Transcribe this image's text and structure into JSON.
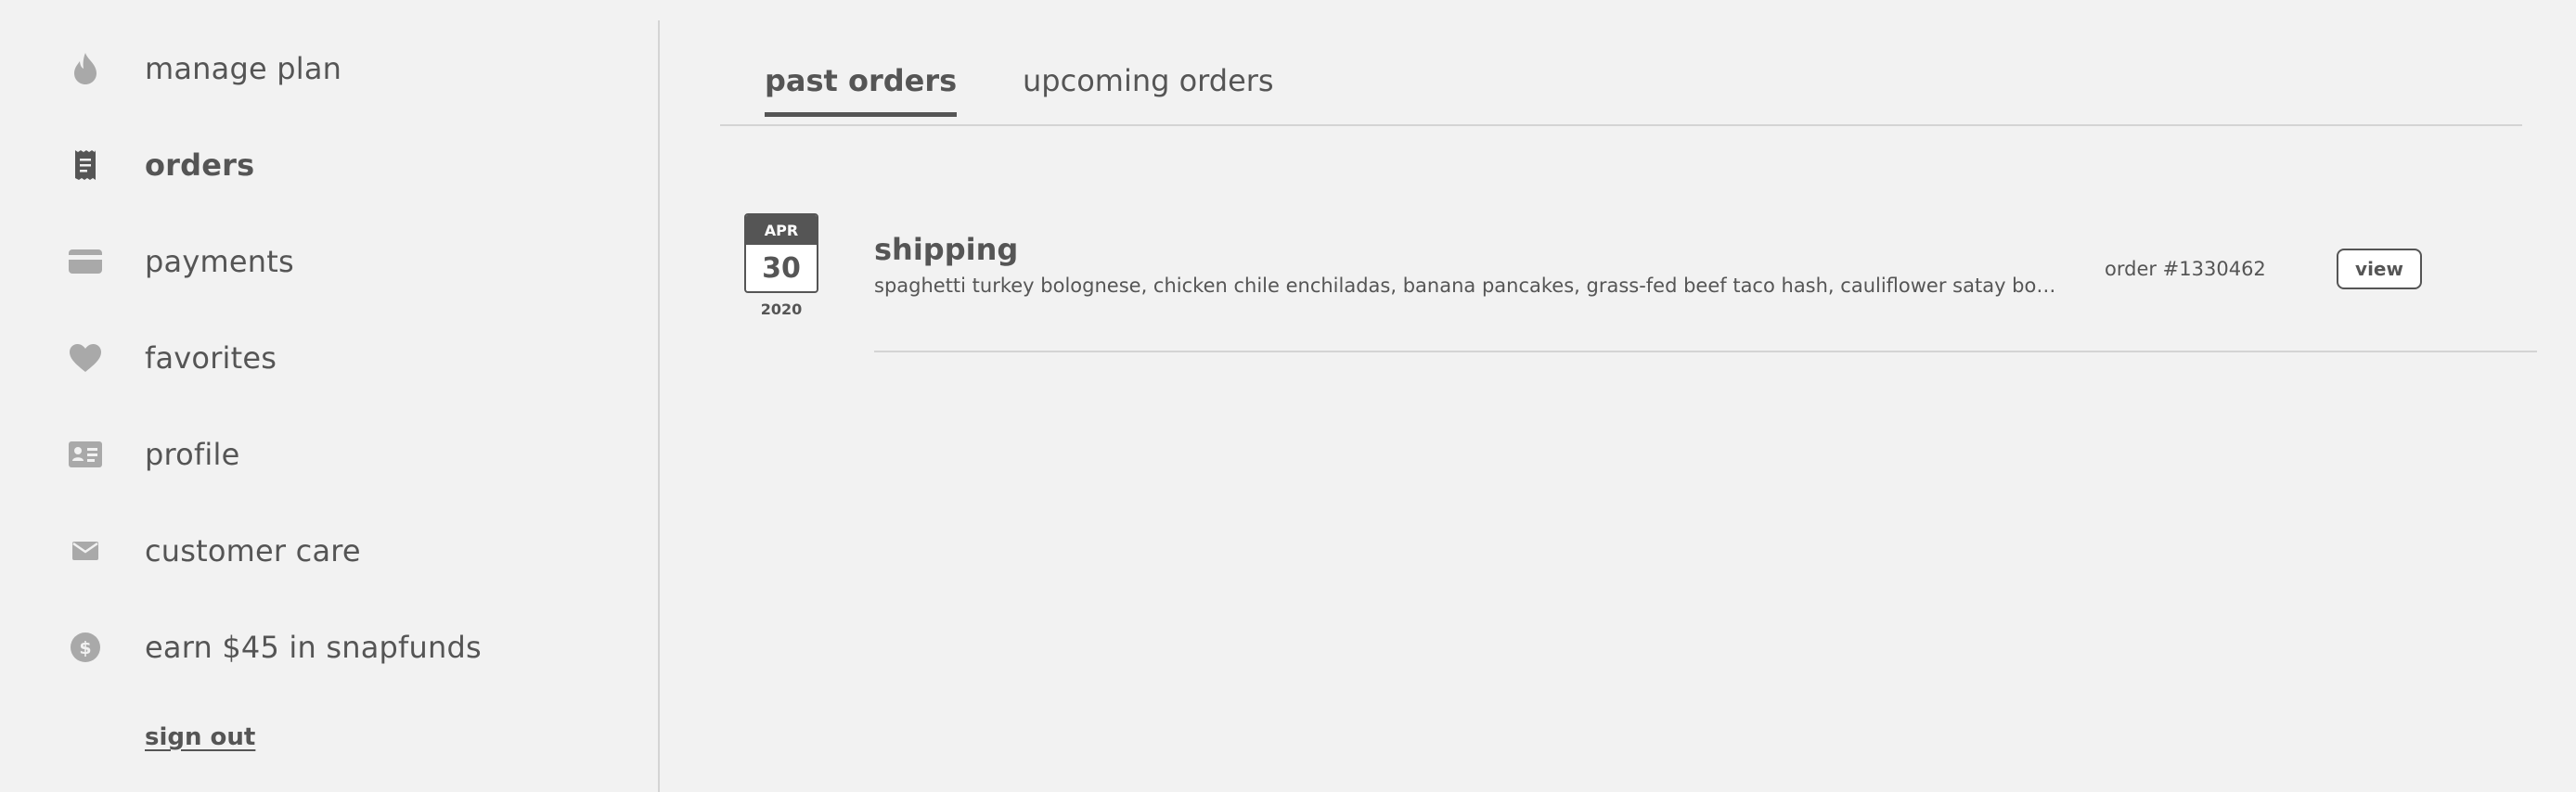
{
  "sidebar": {
    "items": [
      {
        "label": "manage plan",
        "icon": "flame-icon",
        "active": false
      },
      {
        "label": "orders",
        "icon": "receipt-icon",
        "active": true
      },
      {
        "label": "payments",
        "icon": "credit-card-icon",
        "active": false
      },
      {
        "label": "favorites",
        "icon": "heart-icon",
        "active": false
      },
      {
        "label": "profile",
        "icon": "id-card-icon",
        "active": false
      },
      {
        "label": "customer care",
        "icon": "envelope-icon",
        "active": false
      },
      {
        "label": "earn $45 in snapfunds",
        "icon": "dollar-coin-icon",
        "active": false
      }
    ],
    "sign_out": "sign out"
  },
  "tabs": [
    {
      "label": "past orders",
      "active": true
    },
    {
      "label": "upcoming orders",
      "active": false
    }
  ],
  "orders": [
    {
      "month": "APR",
      "day": "30",
      "year": "2020",
      "title": "shipping",
      "items": "spaghetti turkey bolognese, chicken chile enchiladas, banana pancakes, grass-fed beef taco hash, cauliflower satay bowl, chic...",
      "order_number": "order #1330462",
      "view_label": "view"
    }
  ],
  "colors": {
    "background": "#f2f2f2",
    "text": "#555555",
    "icon": "#a9a9a9",
    "divider": "#d4d4d4"
  }
}
